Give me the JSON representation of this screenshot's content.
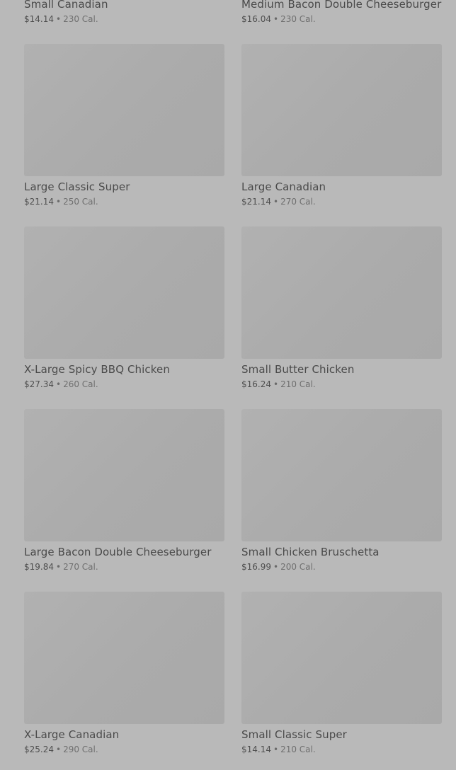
{
  "menu": {
    "items": [
      {
        "name": "Small Canadian",
        "price": "$14.14",
        "separator": "•",
        "calories": "230 Cal."
      },
      {
        "name": "Medium Bacon Double Cheeseburger",
        "price": "$16.04",
        "separator": "•",
        "calories": "230 Cal."
      },
      {
        "name": "Large Classic Super",
        "price": "$21.14",
        "separator": "•",
        "calories": "250 Cal."
      },
      {
        "name": "Large Canadian",
        "price": "$21.14",
        "separator": "•",
        "calories": "270 Cal."
      },
      {
        "name": "X-Large Spicy BBQ Chicken",
        "price": "$27.34",
        "separator": "•",
        "calories": "260 Cal."
      },
      {
        "name": "Small Butter Chicken",
        "price": "$16.24",
        "separator": "•",
        "calories": "210 Cal."
      },
      {
        "name": "Large Bacon Double Cheeseburger",
        "price": "$19.84",
        "separator": "•",
        "calories": "270 Cal."
      },
      {
        "name": "Small Chicken Bruschetta",
        "price": "$16.99",
        "separator": "•",
        "calories": "200 Cal."
      },
      {
        "name": "X-Large Canadian",
        "price": "$25.24",
        "separator": "•",
        "calories": "290 Cal."
      },
      {
        "name": "Small Classic Super",
        "price": "$14.14",
        "separator": "•",
        "calories": "210 Cal."
      }
    ]
  }
}
